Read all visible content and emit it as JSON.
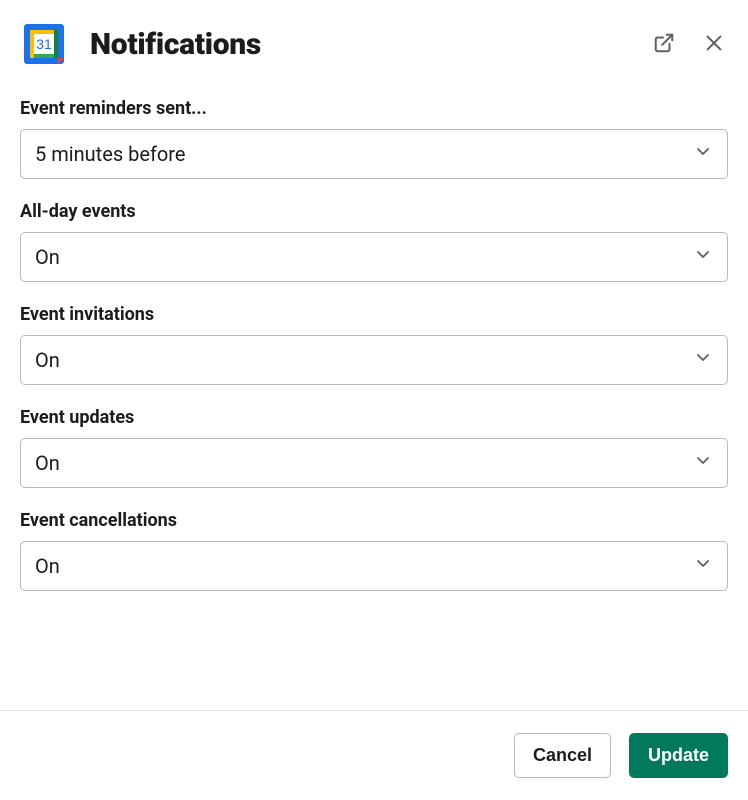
{
  "header": {
    "title": "Notifications",
    "app_icon_day": "31"
  },
  "fields": [
    {
      "label": "Event reminders sent...",
      "value": "5 minutes before"
    },
    {
      "label": "All-day events",
      "value": "On"
    },
    {
      "label": "Event invitations",
      "value": "On"
    },
    {
      "label": "Event updates",
      "value": "On"
    },
    {
      "label": "Event cancellations",
      "value": "On"
    }
  ],
  "footer": {
    "cancel_label": "Cancel",
    "update_label": "Update"
  }
}
